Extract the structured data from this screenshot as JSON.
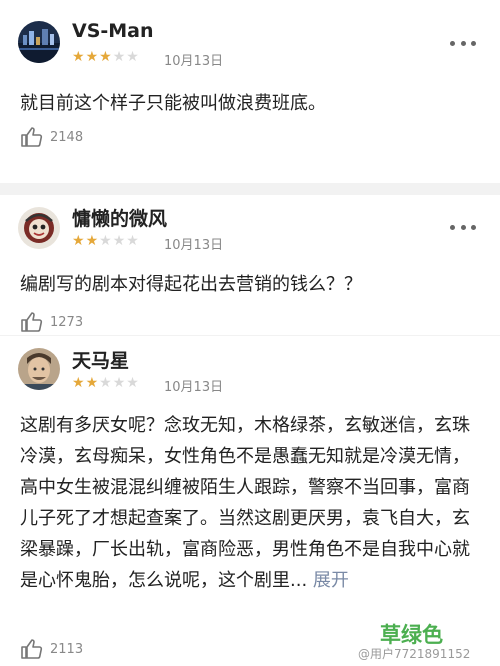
{
  "comments": [
    {
      "username": "VS-Man",
      "rating": 3,
      "stars": "★★★★★",
      "date": "10月13日",
      "text": "就目前这个样子只能被叫做浪费班底。",
      "likes": "2148",
      "expand": ""
    },
    {
      "username": "慵懒的微风",
      "rating": 2,
      "stars": "★★★★★",
      "date": "10月13日",
      "text": "编剧写的剧本对得起花出去营销的钱么？？",
      "likes": "1273",
      "expand": ""
    },
    {
      "username": "天马星",
      "rating": 2,
      "stars": "★★★★★",
      "date": "10月13日",
      "text": "这剧有多厌女呢？念玫无知，木格绿茶，玄敏迷信，玄珠冷漠，玄母痴呆，女性角色不是愚蠢无知就是冷漠无情，高中女生被混混纠缠被陌生人跟踪，警察不当回事，富商儿子死了才想起查案了。当然这剧更厌男，袁飞自大，玄梁暴躁，厂长出轨，富商险恶，男性角色不是自我中心就是心怀鬼胎，怎么说呢，这个剧里...",
      "likes": "2113",
      "expand": "展开"
    }
  ],
  "watermark": {
    "main": "草绿色",
    "sub": "@用户7721891152"
  },
  "icons": {
    "more": "more-horizontal-icon",
    "like": "thumbs-up-icon",
    "rating": "star-icon"
  },
  "colors": {
    "star_on": "#e5a83a",
    "star_off": "#d9d9d9",
    "watermark": "#4caf50",
    "expand_link": "#7a8aa6"
  }
}
